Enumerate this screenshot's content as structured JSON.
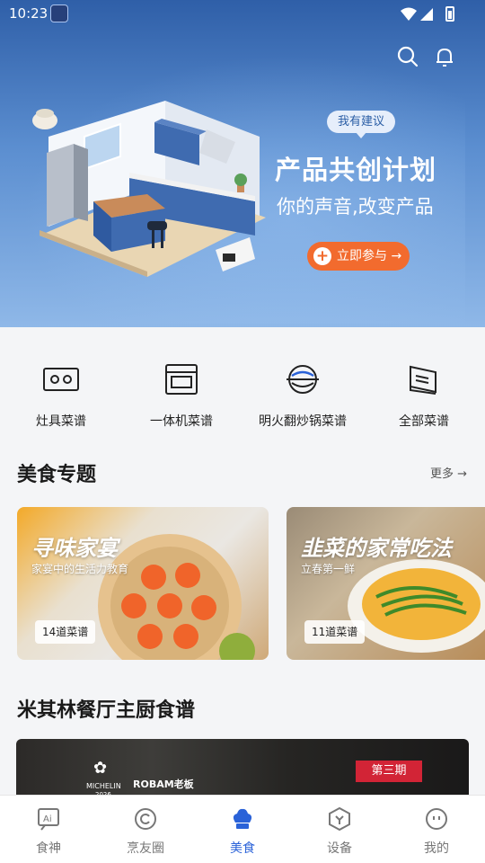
{
  "status_bar": {
    "time": "10:23"
  },
  "hero": {
    "badge": "我有建议",
    "title": "产品共创计划",
    "subtitle": "你的声音,改变产品",
    "join_label": "立即参与 →",
    "join_plus": "+"
  },
  "categories": [
    {
      "label": "灶具菜谱",
      "icon": "stove-icon"
    },
    {
      "label": "一体机菜谱",
      "icon": "oven-icon"
    },
    {
      "label": "明火翻炒锅菜谱",
      "icon": "wok-icon"
    },
    {
      "label": "全部菜谱",
      "icon": "book-icon"
    }
  ],
  "food_topics": {
    "title": "美食专题",
    "more": "更多 →",
    "cards": [
      {
        "title": "寻味家宴",
        "subtitle": "家宴中的生活力教育",
        "count": "14道菜谱"
      },
      {
        "title": "韭菜的家常吃法",
        "subtitle": "立春第一鲜",
        "count": "11道菜谱"
      }
    ]
  },
  "michelin": {
    "title": "米其林餐厅主厨食谱",
    "logo_text": "MICHELIN",
    "year": "2026",
    "brand": "ROBAM老板",
    "issue": "第三期"
  },
  "bottom_nav": [
    {
      "label": "食神",
      "icon": "ai-icon",
      "active": false
    },
    {
      "label": "烹友圈",
      "icon": "circle-icon",
      "active": false
    },
    {
      "label": "美食",
      "icon": "chef-hat-icon",
      "active": true
    },
    {
      "label": "设备",
      "icon": "device-icon",
      "active": false
    },
    {
      "label": "我的",
      "icon": "profile-icon",
      "active": false
    }
  ],
  "colors": {
    "accent": "#2a62d8",
    "join_button": "#f26b2e",
    "issue_badge": "#d22436"
  }
}
